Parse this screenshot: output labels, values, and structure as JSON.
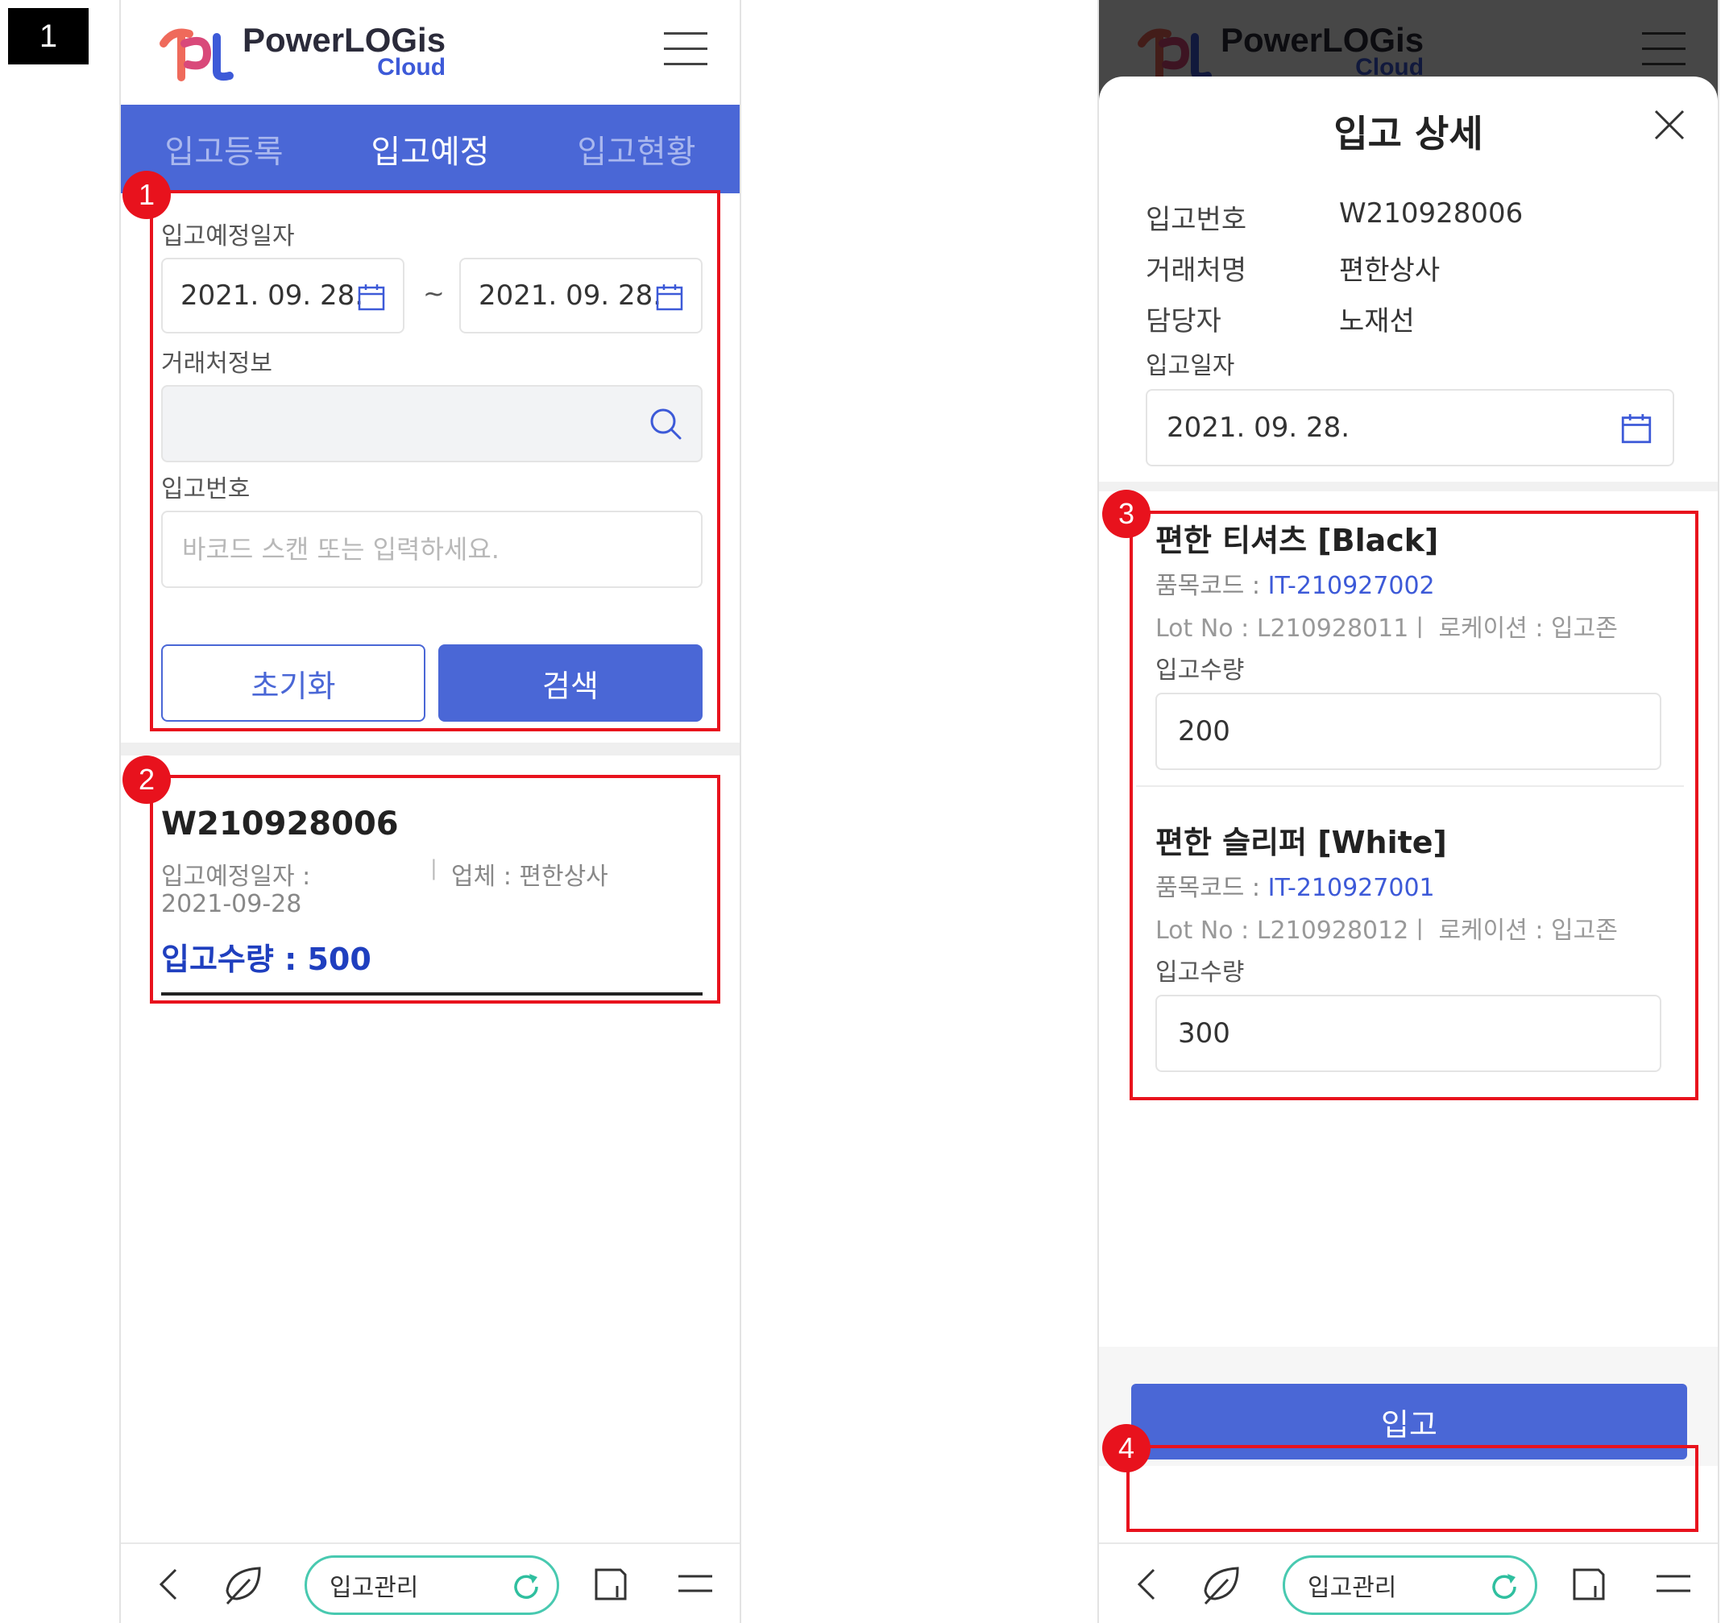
{
  "page_label": "1",
  "app": {
    "logo_main": "PowerLOGis",
    "logo_sub": "Cloud"
  },
  "tabs": [
    {
      "label": "입고등록"
    },
    {
      "label": "입고예정"
    },
    {
      "label": "입고현황"
    }
  ],
  "search": {
    "date_label": "입고예정일자",
    "date_from": "2021. 09. 28.",
    "date_sep": "~",
    "date_to": "2021. 09. 28.",
    "partner_label": "거래처정보",
    "partner_value": "",
    "number_label": "입고번호",
    "number_placeholder": "바코드 스캔 또는 입력하세요.",
    "reset_label": "초기화",
    "search_label": "검색"
  },
  "result": {
    "number": "W210928006",
    "date_label": "입고예정일자 :",
    "sep": "|",
    "vendor": "업체 : 편한상사",
    "date": "2021-09-28",
    "qty": "입고수량 : 500"
  },
  "bottom_bar": {
    "url_label": "입고관리"
  },
  "detail": {
    "title": "입고 상세",
    "fields": [
      {
        "key": "입고번호",
        "value": "W210928006"
      },
      {
        "key": "거래처명",
        "value": "편한상사"
      },
      {
        "key": "담당자",
        "value": "노재선"
      }
    ],
    "date_label": "입고일자",
    "date_value": "2021. 09. 28.",
    "items": [
      {
        "name": "편한 티셔츠 [Black]",
        "code_label": "품목코드 : ",
        "code": "IT-210927002",
        "lot": "Lot No : L210928011ㅣ 로케이션 : 입고존",
        "qty_label": "입고수량",
        "qty": "200"
      },
      {
        "name": "편한 슬리퍼 [White]",
        "code_label": "품목코드 : ",
        "code": "IT-210927001",
        "lot": "Lot No : L210928012ㅣ 로케이션 : 입고존",
        "qty_label": "입고수량",
        "qty": "300"
      }
    ],
    "submit_label": "입고"
  },
  "annotations": [
    "1",
    "2",
    "3",
    "4"
  ],
  "colors": {
    "primary": "#4a67d6",
    "annotation": "#e8121d",
    "link": "#3d5ad8",
    "url_border": "#48c9b0"
  },
  "icons": [
    "hamburger-icon",
    "calendar-icon",
    "search-icon",
    "close-icon",
    "back-icon",
    "leaf-icon",
    "reload-icon",
    "tabs-icon",
    "menu-icon"
  ]
}
